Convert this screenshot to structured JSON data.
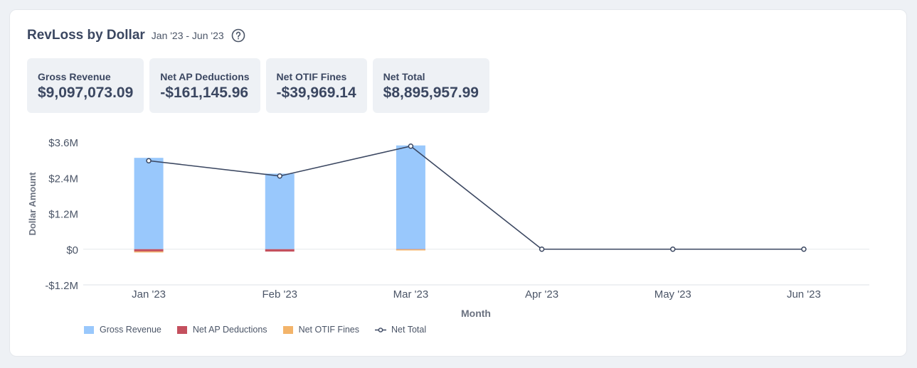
{
  "header": {
    "title": "RevLoss by Dollar",
    "date_range": "Jan '23 - Jun '23",
    "help_icon": "question-circle-icon"
  },
  "stats": [
    {
      "label": "Gross Revenue",
      "value": "$9,097,073.09"
    },
    {
      "label": "Net AP Deductions",
      "value": "-$161,145.96"
    },
    {
      "label": "Net OTIF Fines",
      "value": "-$39,969.14"
    },
    {
      "label": "Net Total",
      "value": "$8,895,957.99"
    }
  ],
  "colors": {
    "gross_revenue": "#99c8fc",
    "net_ap_deductions": "#c4505e",
    "net_otif_fines": "#f3b46a",
    "net_total": "#3b4761",
    "grid": "#e9ecef"
  },
  "chart_data": {
    "type": "bar",
    "subtype": "stacked bar with line overlay",
    "title": "",
    "xlabel": "Month",
    "ylabel": "Dollar Amount",
    "categories": [
      "Jan '23",
      "Feb '23",
      "Mar '23",
      "Apr '23",
      "May '23",
      "Jun '23"
    ],
    "ylim": [
      -1200000,
      3600000
    ],
    "yticks": [
      3600000,
      2400000,
      1200000,
      0,
      -1200000
    ],
    "ytick_labels": [
      "$3.6M",
      "$2.4M",
      "$1.2M",
      "$0",
      "-$1.2M"
    ],
    "grid": true,
    "legend_position": "bottom-left",
    "series": [
      {
        "name": "Gross Revenue",
        "type": "bar",
        "values": [
          3070000,
          2540000,
          3487073
        ]
      },
      {
        "name": "Net AP Deductions",
        "type": "bar",
        "values": [
          -75000,
          -80000,
          -6146
        ]
      },
      {
        "name": "Net OTIF Fines",
        "type": "bar",
        "values": [
          -22000,
          0,
          -17969
        ]
      },
      {
        "name": "Net Total",
        "type": "line",
        "values": [
          2973000,
          2460000,
          3462958,
          0,
          0,
          0
        ]
      }
    ]
  }
}
